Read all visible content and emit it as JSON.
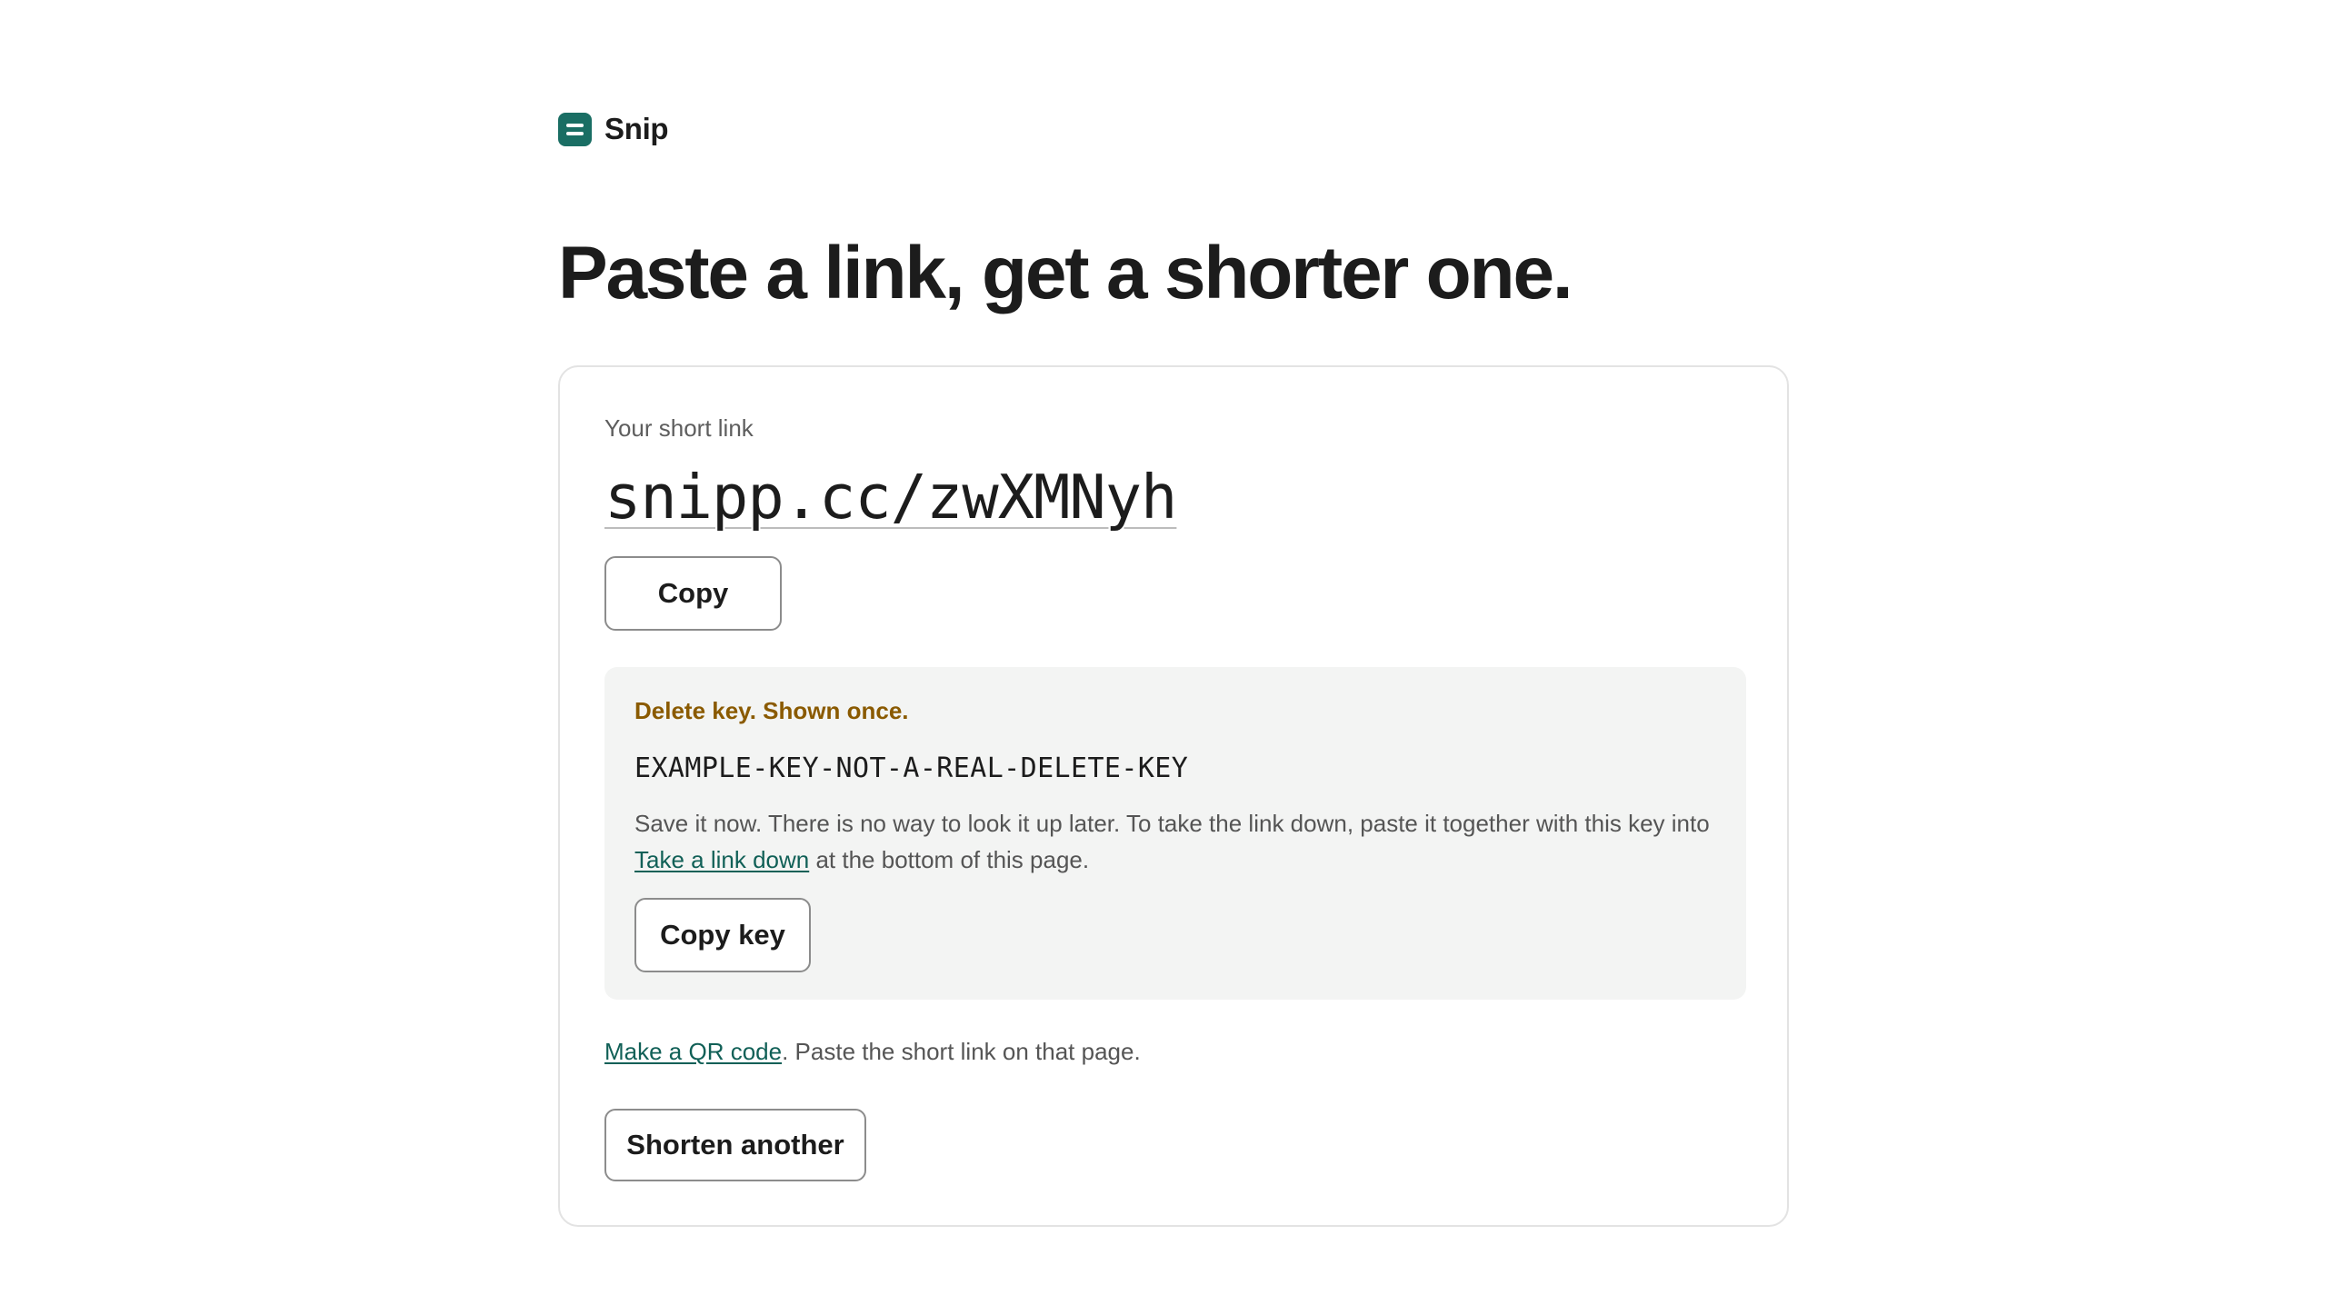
{
  "brand": {
    "name": "Snip",
    "logo_icon": "snip-logo-icon",
    "accent_color": "#1a6e64"
  },
  "headline": "Paste a link, get a shorter one.",
  "result": {
    "label": "Your short link",
    "short_link": "snipp.cc/zwXMNyh",
    "copy_button": "Copy"
  },
  "delete_key": {
    "title": "Delete key. Shown once.",
    "key": "EXAMPLE-KEY-NOT-A-REAL-DELETE-KEY",
    "help_before": "Save it now. There is no way to look it up later. To take the link down, paste it together with this key into ",
    "help_link": "Take a link down",
    "help_after": " at the bottom of this page.",
    "copy_button": "Copy key",
    "title_color": "#8a5a00"
  },
  "qr": {
    "link": "Make a QR code",
    "text": ". Paste the short link on that page."
  },
  "shorten_another_button": "Shorten another"
}
